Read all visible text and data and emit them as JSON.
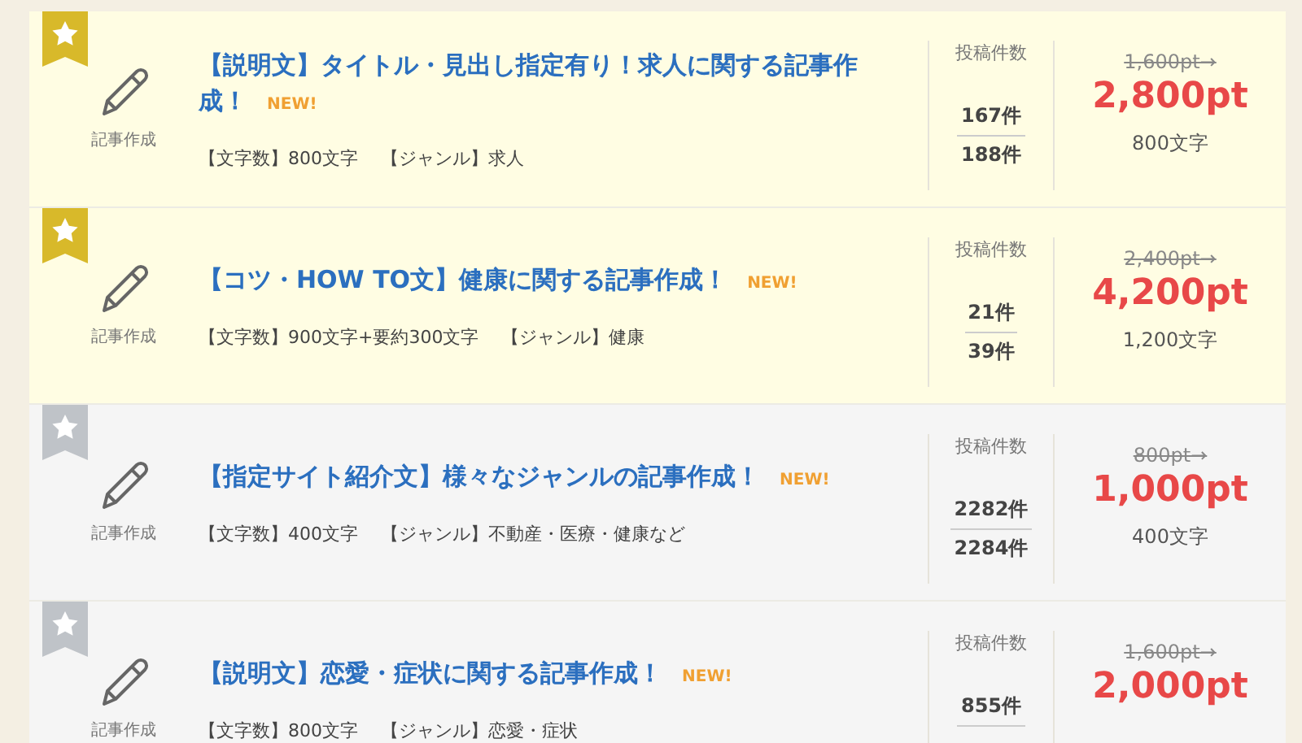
{
  "jobs": [
    {
      "featured": true,
      "icon_label": "記事作成",
      "title": "【説明文】タイトル・見出し指定有り！求人に関する記事作成！",
      "badge": "NEW!",
      "meta": [
        "【文字数】800文字",
        "【ジャンル】求人"
      ],
      "count_label": "投稿件数",
      "count_current": "167件",
      "count_total": "188件",
      "old_price": "1,600pt→",
      "price": "2,800pt",
      "chars": "800文字"
    },
    {
      "featured": true,
      "icon_label": "記事作成",
      "title": "【コツ・HOW TO文】健康に関する記事作成！",
      "badge": "NEW!",
      "meta": [
        "【文字数】900文字+要約300文字",
        "【ジャンル】健康"
      ],
      "count_label": "投稿件数",
      "count_current": "21件",
      "count_total": "39件",
      "old_price": "2,400pt→",
      "price": "4,200pt",
      "chars": "1,200文字"
    },
    {
      "featured": false,
      "icon_label": "記事作成",
      "title": "【指定サイト紹介文】様々なジャンルの記事作成！",
      "badge": "NEW!",
      "meta": [
        "【文字数】400文字",
        "【ジャンル】不動産・医療・健康など"
      ],
      "count_label": "投稿件数",
      "count_current": "2282件",
      "count_total": "2284件",
      "old_price": "800pt→",
      "price": "1,000pt",
      "chars": "400文字"
    },
    {
      "featured": false,
      "icon_label": "記事作成",
      "title": "【説明文】恋愛・症状に関する記事作成！",
      "badge": "NEW!",
      "meta": [
        "【文字数】800文字",
        "【ジャンル】恋愛・症状"
      ],
      "count_label": "投稿件数",
      "count_current": "855件",
      "old_price": "1,600pt→",
      "price": "2,000pt"
    }
  ]
}
